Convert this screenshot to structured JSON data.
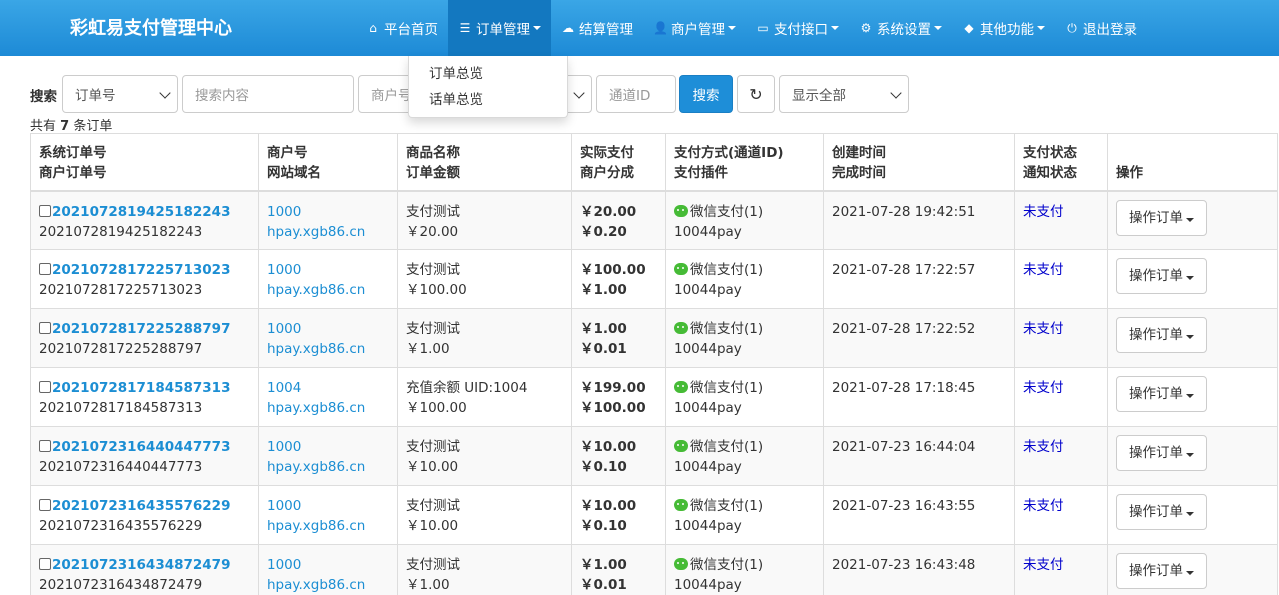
{
  "brand": "彩虹易支付管理中心",
  "nav": [
    {
      "icon": "home-icon",
      "glyph": "⌂",
      "label": "平台首页",
      "dropdown": false,
      "active": false
    },
    {
      "icon": "list-icon",
      "glyph": "☰",
      "label": "订单管理",
      "dropdown": true,
      "active": true
    },
    {
      "icon": "cloud-icon",
      "glyph": "☁",
      "label": "结算管理",
      "dropdown": false,
      "active": false
    },
    {
      "icon": "user-icon",
      "glyph": "👤",
      "label": "商户管理",
      "dropdown": true,
      "active": false
    },
    {
      "icon": "card-icon",
      "glyph": "▭",
      "label": "支付接口",
      "dropdown": true,
      "active": false
    },
    {
      "icon": "gear-icon",
      "glyph": "⚙",
      "label": "系统设置",
      "dropdown": true,
      "active": false
    },
    {
      "icon": "cube-icon",
      "glyph": "◆",
      "label": "其他功能",
      "dropdown": true,
      "active": false
    },
    {
      "icon": "power-icon",
      "glyph": "⏻",
      "label": "退出登录",
      "dropdown": false,
      "active": false
    }
  ],
  "dropdown": {
    "items": [
      "订单总览",
      "话单总览"
    ]
  },
  "search": {
    "label": "搜索",
    "field_select": "订单号",
    "keyword_placeholder": "搜索内容",
    "merchant_placeholder": "商户号",
    "channel_placeholder": "通道ID",
    "button": "搜索",
    "filter_select": "显示全部"
  },
  "summary": {
    "prefix": "共有",
    "count": "7",
    "suffix": "条订单"
  },
  "columns": [
    [
      "系统订单号",
      "商户订单号"
    ],
    [
      "商户号",
      "网站域名"
    ],
    [
      "商品名称",
      "订单金额"
    ],
    [
      "实际支付",
      "商户分成"
    ],
    [
      "支付方式(通道ID)",
      "支付插件"
    ],
    [
      "创建时间",
      "完成时间"
    ],
    [
      "支付状态",
      "通知状态"
    ],
    [
      "",
      "操作"
    ]
  ],
  "rows": [
    {
      "trade_no": "2021072819425182243",
      "out_trade_no": "2021072819425182243",
      "uid": "1000",
      "domain": "hpay.xgb86.cn",
      "name": "支付测试",
      "money": "￥20.00",
      "realmoney": "￥20.00",
      "getmoney": "￥0.20",
      "type": "微信支付(1)",
      "plugin": "10044pay",
      "addtime": "2021-07-28 19:42:51",
      "endtime": "",
      "status": "未支付",
      "op": "操作订单"
    },
    {
      "trade_no": "2021072817225713023",
      "out_trade_no": "2021072817225713023",
      "uid": "1000",
      "domain": "hpay.xgb86.cn",
      "name": "支付测试",
      "money": "￥100.00",
      "realmoney": "￥100.00",
      "getmoney": "￥1.00",
      "type": "微信支付(1)",
      "plugin": "10044pay",
      "addtime": "2021-07-28 17:22:57",
      "endtime": "",
      "status": "未支付",
      "op": "操作订单"
    },
    {
      "trade_no": "2021072817225288797",
      "out_trade_no": "2021072817225288797",
      "uid": "1000",
      "domain": "hpay.xgb86.cn",
      "name": "支付测试",
      "money": "￥1.00",
      "realmoney": "￥1.00",
      "getmoney": "￥0.01",
      "type": "微信支付(1)",
      "plugin": "10044pay",
      "addtime": "2021-07-28 17:22:52",
      "endtime": "",
      "status": "未支付",
      "op": "操作订单"
    },
    {
      "trade_no": "2021072817184587313",
      "out_trade_no": "2021072817184587313",
      "uid": "1004",
      "domain": "hpay.xgb86.cn",
      "name": "充值余额 UID:1004",
      "money": "￥100.00",
      "realmoney": "￥199.00",
      "getmoney": "￥100.00",
      "type": "微信支付(1)",
      "plugin": "10044pay",
      "addtime": "2021-07-28 17:18:45",
      "endtime": "",
      "status": "未支付",
      "op": "操作订单"
    },
    {
      "trade_no": "2021072316440447773",
      "out_trade_no": "2021072316440447773",
      "uid": "1000",
      "domain": "hpay.xgb86.cn",
      "name": "支付测试",
      "money": "￥10.00",
      "realmoney": "￥10.00",
      "getmoney": "￥0.10",
      "type": "微信支付(1)",
      "plugin": "10044pay",
      "addtime": "2021-07-23 16:44:04",
      "endtime": "",
      "status": "未支付",
      "op": "操作订单"
    },
    {
      "trade_no": "2021072316435576229",
      "out_trade_no": "2021072316435576229",
      "uid": "1000",
      "domain": "hpay.xgb86.cn",
      "name": "支付测试",
      "money": "￥10.00",
      "realmoney": "￥10.00",
      "getmoney": "￥0.10",
      "type": "微信支付(1)",
      "plugin": "10044pay",
      "addtime": "2021-07-23 16:43:55",
      "endtime": "",
      "status": "未支付",
      "op": "操作订单"
    },
    {
      "trade_no": "2021072316434872479",
      "out_trade_no": "2021072316434872479",
      "uid": "1000",
      "domain": "hpay.xgb86.cn",
      "name": "支付测试",
      "money": "￥1.00",
      "realmoney": "￥1.00",
      "getmoney": "￥0.01",
      "type": "微信支付(1)",
      "plugin": "10044pay",
      "addtime": "2021-07-23 16:43:48",
      "endtime": "",
      "status": "未支付",
      "op": "操作订单"
    }
  ]
}
